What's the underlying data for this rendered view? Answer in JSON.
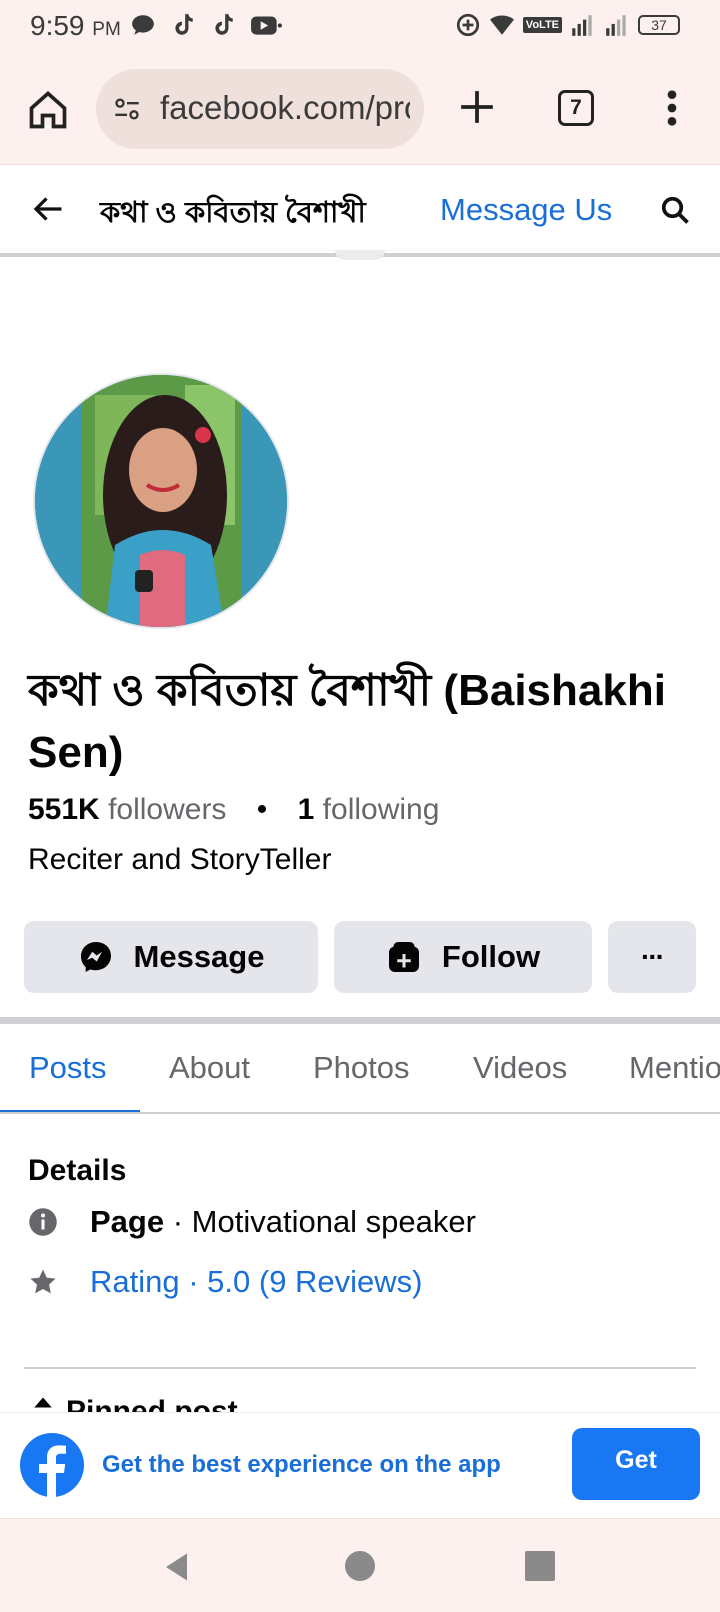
{
  "status_bar": {
    "time": "9:59",
    "ampm": "PM",
    "volte": "VoLTE",
    "battery": "37"
  },
  "browser": {
    "url": "facebook.com/profile",
    "tab_count": "7"
  },
  "header": {
    "title": "কথা ও কবিতায় বৈশাখী",
    "message_us": "Message Us"
  },
  "profile": {
    "name": "কথা ও কবিতায় বৈশাখী (Baishakhi Sen)",
    "followers_count": "551K",
    "followers_label": "followers",
    "separator": "•",
    "following_count": "1",
    "following_label": "following",
    "intro": "Reciter and StoryTeller"
  },
  "actions": {
    "message": "Message",
    "follow": "Follow",
    "more": "···"
  },
  "tabs": [
    {
      "label": "Posts",
      "active": true
    },
    {
      "label": "About",
      "active": false
    },
    {
      "label": "Photos",
      "active": false
    },
    {
      "label": "Videos",
      "active": false
    },
    {
      "label": "Mentions",
      "active": false
    }
  ],
  "details": {
    "heading": "Details",
    "page_label": "Page",
    "page_category": " · Motivational speaker",
    "rating": "Rating · 5.0 (9 Reviews)",
    "pinned": "Pinned post"
  },
  "app_banner": {
    "text": "Get the best experience on the app",
    "button": "Get"
  },
  "colors": {
    "accent": "#1a6ed8",
    "fb_blue": "#1877f2",
    "chrome_bg": "#fdf1ef",
    "button_grey": "#e4e6eb"
  }
}
